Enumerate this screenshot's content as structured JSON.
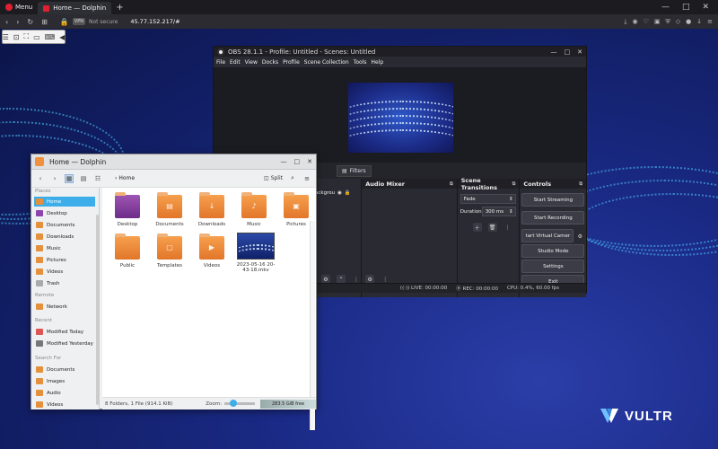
{
  "browser": {
    "menu_label": "Menu",
    "tab_title": "Home — Dolphin",
    "new_tab": "+",
    "security_badge": "VPN",
    "not_secure": "Not secure",
    "address": "45.77.152.217/#",
    "window_controls": [
      "—",
      "□",
      "✕"
    ]
  },
  "vnc_toolbar": [
    "☰",
    "⊡",
    "⛶",
    "▭",
    "⌨",
    "◀"
  ],
  "brand": {
    "logo_text": "VULTR",
    "accent": "#3daee9"
  },
  "obs": {
    "title": "OBS 28.1.1 - Profile: Untitled - Scenes: Untitled",
    "menu": [
      "File",
      "Edit",
      "View",
      "Docks",
      "Profile",
      "Scene Collection",
      "Tools",
      "Help"
    ],
    "tab_properties": "ties",
    "tab_filters": "Filters",
    "sources_partial": "ackgrou",
    "audio_mixer": "Audio Mixer",
    "scene_transitions": "Scene Transitions",
    "transition_value": "Fade",
    "duration_label": "Duration",
    "duration_value": "300 ms",
    "controls_title": "Controls",
    "controls": [
      "Start Streaming",
      "Start Recording",
      "tart Virtual Camer",
      "Studio Mode",
      "Settings",
      "Exit"
    ],
    "status_live": "LIVE: 00:00:00",
    "status_rec": "REC: 00:00:00",
    "status_cpu": "CPU: 0.4%, 60.00 fps"
  },
  "dolphin": {
    "title": "Home — Dolphin",
    "breadcrumb": "Home",
    "split_label": "Split",
    "places_header": "Places",
    "places": [
      "Home",
      "Desktop",
      "Documents",
      "Downloads",
      "Music",
      "Pictures",
      "Videos",
      "Trash"
    ],
    "remote_header": "Remote",
    "remote": [
      "Network"
    ],
    "recent_header": "Recent",
    "recent": [
      "Modified Today",
      "Modified Yesterday"
    ],
    "search_header": "Search For",
    "search": [
      "Documents",
      "Images",
      "Audio",
      "Videos"
    ],
    "files": [
      "Desktop",
      "Documents",
      "Downloads",
      "Music",
      "Pictures",
      "Public",
      "Templates",
      "Videos",
      "2023-05-16 20-43-18.mkv"
    ],
    "status_text": "8 Folders, 1 File (914.1 KiB)",
    "zoom_label": "Zoom:",
    "free_space": "283.5 GiB free"
  }
}
